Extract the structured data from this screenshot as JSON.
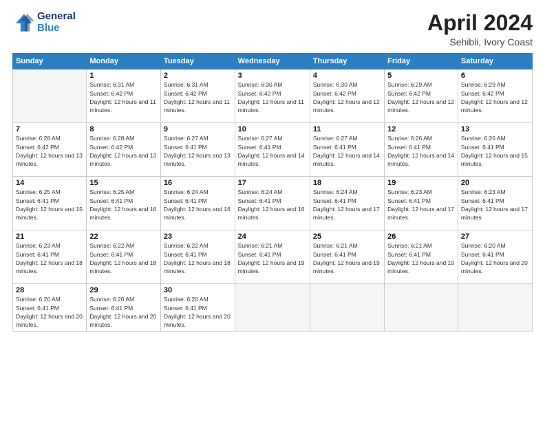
{
  "header": {
    "logo_line1": "General",
    "logo_line2": "Blue",
    "month": "April 2024",
    "location": "Sehibli, Ivory Coast"
  },
  "weekdays": [
    "Sunday",
    "Monday",
    "Tuesday",
    "Wednesday",
    "Thursday",
    "Friday",
    "Saturday"
  ],
  "weeks": [
    [
      {
        "day": "",
        "empty": true
      },
      {
        "day": "1",
        "sunrise": "Sunrise: 6:31 AM",
        "sunset": "Sunset: 6:42 PM",
        "daylight": "Daylight: 12 hours and 11 minutes."
      },
      {
        "day": "2",
        "sunrise": "Sunrise: 6:31 AM",
        "sunset": "Sunset: 6:42 PM",
        "daylight": "Daylight: 12 hours and 11 minutes."
      },
      {
        "day": "3",
        "sunrise": "Sunrise: 6:30 AM",
        "sunset": "Sunset: 6:42 PM",
        "daylight": "Daylight: 12 hours and 11 minutes."
      },
      {
        "day": "4",
        "sunrise": "Sunrise: 6:30 AM",
        "sunset": "Sunset: 6:42 PM",
        "daylight": "Daylight: 12 hours and 12 minutes."
      },
      {
        "day": "5",
        "sunrise": "Sunrise: 6:29 AM",
        "sunset": "Sunset: 6:42 PM",
        "daylight": "Daylight: 12 hours and 12 minutes."
      },
      {
        "day": "6",
        "sunrise": "Sunrise: 6:29 AM",
        "sunset": "Sunset: 6:42 PM",
        "daylight": "Daylight: 12 hours and 12 minutes."
      }
    ],
    [
      {
        "day": "7",
        "sunrise": "Sunrise: 6:28 AM",
        "sunset": "Sunset: 6:42 PM",
        "daylight": "Daylight: 12 hours and 13 minutes."
      },
      {
        "day": "8",
        "sunrise": "Sunrise: 6:28 AM",
        "sunset": "Sunset: 6:42 PM",
        "daylight": "Daylight: 12 hours and 13 minutes."
      },
      {
        "day": "9",
        "sunrise": "Sunrise: 6:27 AM",
        "sunset": "Sunset: 6:41 PM",
        "daylight": "Daylight: 12 hours and 13 minutes."
      },
      {
        "day": "10",
        "sunrise": "Sunrise: 6:27 AM",
        "sunset": "Sunset: 6:41 PM",
        "daylight": "Daylight: 12 hours and 14 minutes."
      },
      {
        "day": "11",
        "sunrise": "Sunrise: 6:27 AM",
        "sunset": "Sunset: 6:41 PM",
        "daylight": "Daylight: 12 hours and 14 minutes."
      },
      {
        "day": "12",
        "sunrise": "Sunrise: 6:26 AM",
        "sunset": "Sunset: 6:41 PM",
        "daylight": "Daylight: 12 hours and 14 minutes."
      },
      {
        "day": "13",
        "sunrise": "Sunrise: 6:26 AM",
        "sunset": "Sunset: 6:41 PM",
        "daylight": "Daylight: 12 hours and 15 minutes."
      }
    ],
    [
      {
        "day": "14",
        "sunrise": "Sunrise: 6:25 AM",
        "sunset": "Sunset: 6:41 PM",
        "daylight": "Daylight: 12 hours and 15 minutes."
      },
      {
        "day": "15",
        "sunrise": "Sunrise: 6:25 AM",
        "sunset": "Sunset: 6:41 PM",
        "daylight": "Daylight: 12 hours and 16 minutes."
      },
      {
        "day": "16",
        "sunrise": "Sunrise: 6:24 AM",
        "sunset": "Sunset: 6:41 PM",
        "daylight": "Daylight: 12 hours and 16 minutes."
      },
      {
        "day": "17",
        "sunrise": "Sunrise: 6:24 AM",
        "sunset": "Sunset: 6:41 PM",
        "daylight": "Daylight: 12 hours and 16 minutes."
      },
      {
        "day": "18",
        "sunrise": "Sunrise: 6:24 AM",
        "sunset": "Sunset: 6:41 PM",
        "daylight": "Daylight: 12 hours and 17 minutes."
      },
      {
        "day": "19",
        "sunrise": "Sunrise: 6:23 AM",
        "sunset": "Sunset: 6:41 PM",
        "daylight": "Daylight: 12 hours and 17 minutes."
      },
      {
        "day": "20",
        "sunrise": "Sunrise: 6:23 AM",
        "sunset": "Sunset: 6:41 PM",
        "daylight": "Daylight: 12 hours and 17 minutes."
      }
    ],
    [
      {
        "day": "21",
        "sunrise": "Sunrise: 6:23 AM",
        "sunset": "Sunset: 6:41 PM",
        "daylight": "Daylight: 12 hours and 18 minutes."
      },
      {
        "day": "22",
        "sunrise": "Sunrise: 6:22 AM",
        "sunset": "Sunset: 6:41 PM",
        "daylight": "Daylight: 12 hours and 18 minutes."
      },
      {
        "day": "23",
        "sunrise": "Sunrise: 6:22 AM",
        "sunset": "Sunset: 6:41 PM",
        "daylight": "Daylight: 12 hours and 18 minutes."
      },
      {
        "day": "24",
        "sunrise": "Sunrise: 6:21 AM",
        "sunset": "Sunset: 6:41 PM",
        "daylight": "Daylight: 12 hours and 19 minutes."
      },
      {
        "day": "25",
        "sunrise": "Sunrise: 6:21 AM",
        "sunset": "Sunset: 6:41 PM",
        "daylight": "Daylight: 12 hours and 19 minutes."
      },
      {
        "day": "26",
        "sunrise": "Sunrise: 6:21 AM",
        "sunset": "Sunset: 6:41 PM",
        "daylight": "Daylight: 12 hours and 19 minutes."
      },
      {
        "day": "27",
        "sunrise": "Sunrise: 6:20 AM",
        "sunset": "Sunset: 6:41 PM",
        "daylight": "Daylight: 12 hours and 20 minutes."
      }
    ],
    [
      {
        "day": "28",
        "sunrise": "Sunrise: 6:20 AM",
        "sunset": "Sunset: 6:41 PM",
        "daylight": "Daylight: 12 hours and 20 minutes."
      },
      {
        "day": "29",
        "sunrise": "Sunrise: 6:20 AM",
        "sunset": "Sunset: 6:41 PM",
        "daylight": "Daylight: 12 hours and 20 minutes."
      },
      {
        "day": "30",
        "sunrise": "Sunrise: 6:20 AM",
        "sunset": "Sunset: 6:41 PM",
        "daylight": "Daylight: 12 hours and 20 minutes."
      },
      {
        "day": "",
        "empty": true
      },
      {
        "day": "",
        "empty": true
      },
      {
        "day": "",
        "empty": true
      },
      {
        "day": "",
        "empty": true
      }
    ]
  ]
}
